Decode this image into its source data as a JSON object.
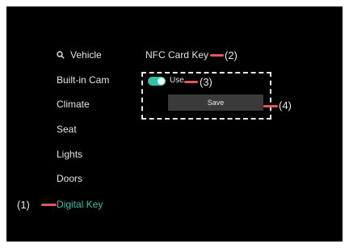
{
  "sidebar": {
    "items": [
      {
        "label": "Vehicle",
        "icon": "search-icon"
      },
      {
        "label": "Built-in Cam"
      },
      {
        "label": "Climate"
      },
      {
        "label": "Seat"
      },
      {
        "label": "Lights"
      },
      {
        "label": "Doors"
      },
      {
        "label": "Digital Key",
        "active": true
      }
    ]
  },
  "main": {
    "title": "NFC Card Key",
    "toggle": {
      "label": "Use",
      "state": "on"
    },
    "save_label": "Save"
  },
  "callouts": {
    "c1": "(1)",
    "c2": "(2)",
    "c3": "(3)",
    "c4": "(4)"
  },
  "colors": {
    "accent": "#2fc1a6",
    "callout_line": "#e0595a",
    "background": "#000000"
  }
}
